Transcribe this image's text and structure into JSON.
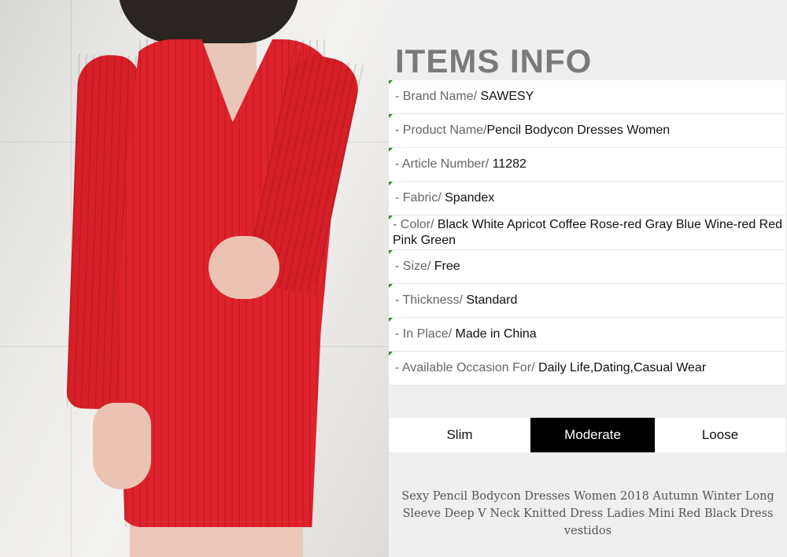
{
  "title": "ITEMS INFO",
  "info": [
    {
      "label": "- Brand Name/ ",
      "value": "SAWESY"
    },
    {
      "label": "- Product Name/",
      "value": "Pencil Bodycon Dresses Women"
    },
    {
      "label": "- Article Number/ ",
      "value": "11282"
    },
    {
      "label": "- Fabric/ ",
      "value": "Spandex"
    },
    {
      "label": "- Color/ ",
      "value": "Black White Apricot Coffee Rose-red Gray Blue Wine-red Red Pink Green"
    },
    {
      "label": "- Size/ ",
      "value": "Free"
    },
    {
      "label": "- Thickness/ ",
      "value": "Standard"
    },
    {
      "label": "- In Place/ ",
      "value": "Made in China"
    },
    {
      "label": "- Available Occasion For/ ",
      "value": "Daily Life,Dating,Casual Wear"
    }
  ],
  "fit": {
    "options": [
      "Slim",
      "Moderate",
      "Loose"
    ],
    "selected": "Moderate"
  },
  "caption": "Sexy Pencil Bodycon Dresses Women 2018 Autumn Winter Long Sleeve Deep V Neck Knitted Dress Ladies Mini Red Black Dress vestidos",
  "colors": {
    "dress": "#e0222c",
    "title": "#7a7a7a",
    "selected_bg": "#000000",
    "tick": "#2e8b2e"
  }
}
